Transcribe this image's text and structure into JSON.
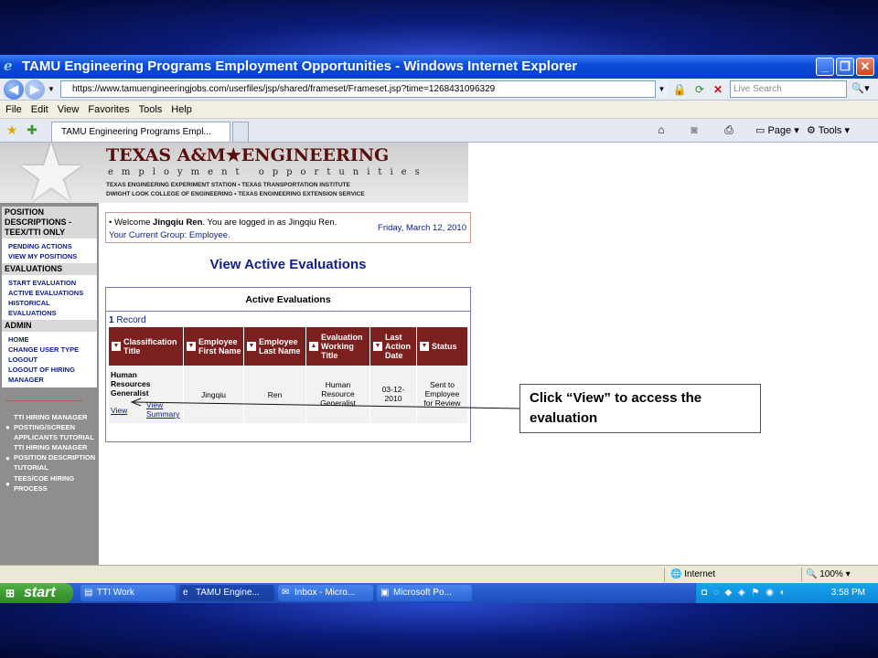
{
  "window": {
    "title": "TAMU Engineering Programs Employment Opportunities - Windows Internet Explorer",
    "url": "https://www.tamuengineeringjobs.com/userfiles/jsp/shared/frameset/Frameset.jsp?time=1268431096329",
    "search_placeholder": "Live Search",
    "minimize": "_",
    "maximize": "❐",
    "close": "✕"
  },
  "menu": [
    "File",
    "Edit",
    "View",
    "Favorites",
    "Tools",
    "Help"
  ],
  "tab": {
    "label": "TAMU Engineering Programs Empl..."
  },
  "toolbar_right": {
    "page": "Page",
    "tools": "Tools"
  },
  "brand": {
    "name": "TEXAS A&M★ENGINEERING",
    "tagline": "employment opportunities",
    "line1": "TEXAS ENGINEERING EXPERIMENT STATION • TEXAS TRANSPORTATION INSTITUTE",
    "line2": "DWIGHT LOOK COLLEGE OF ENGINEERING • TEXAS ENGINEERING EXTENSION SERVICE"
  },
  "sidebar": {
    "sections": [
      {
        "header": "POSITION DESCRIPTIONS - TEEX/TTI ONLY",
        "items": [
          "PENDING ACTIONS",
          "VIEW MY POSITIONS"
        ]
      },
      {
        "header": "EVALUATIONS",
        "items": [
          "START EVALUATION",
          "ACTIVE EVALUATIONS",
          "HISTORICAL EVALUATIONS"
        ]
      },
      {
        "header": "ADMIN",
        "items": [
          "HOME",
          "CHANGE USER TYPE",
          "LOGOUT",
          "LOGOUT OF HIRING MANAGER"
        ]
      }
    ],
    "links": [
      "TTI HIRING MANAGER POSTING/SCREEN APPLICANTS TUTORIAL",
      "TTI HIRING MANAGER POSITION DESCRIPTION TUTORIAL",
      "TEES/COE HIRING PROCESS"
    ]
  },
  "welcome": {
    "line1_pre": "• Welcome ",
    "line1_name": "Jingqiu Ren",
    "line1_post": ". You are logged in as Jingqiu Ren.",
    "line2": "Your Current Group: Employee.",
    "date": "Friday, March 12, 2010"
  },
  "page_title": "View Active Evaluations",
  "panel": {
    "title": "Active Evaluations",
    "record_count": "1",
    "record_label": " Record",
    "columns": [
      {
        "label": "Classification Title",
        "sort": "▼"
      },
      {
        "label": "Employee First Name",
        "sort": "▼"
      },
      {
        "label": "Employee Last Name",
        "sort": "▼"
      },
      {
        "label": "Evaluation Working Title",
        "sort": "▲"
      },
      {
        "label": "Last Action Date",
        "sort": "▼"
      },
      {
        "label": "Status",
        "sort": "▼"
      }
    ],
    "row": {
      "classification": "Human Resources Generalist",
      "view_link": "View",
      "view_summary_link": "View Summary",
      "first_name": "Jingqiu",
      "last_name": "Ren",
      "working_title": "Human Resource Generalist",
      "last_action_date": "03-12-2010",
      "status": "Sent to Employee for Review"
    }
  },
  "callout": {
    "text": "Click “View” to access the evaluation"
  },
  "statusbar": {
    "zone": "Internet",
    "zoom": "100%"
  },
  "taskbar": {
    "start": "start",
    "tasks": [
      "TTI Work",
      "TAMU Engine...",
      "Inbox - Micro...",
      "Microsoft Po..."
    ],
    "clock": "3:58 PM"
  },
  "colors": {
    "accent": "#7b1f1f",
    "link": "#10208a",
    "titlebar": "#0a4bd8"
  }
}
